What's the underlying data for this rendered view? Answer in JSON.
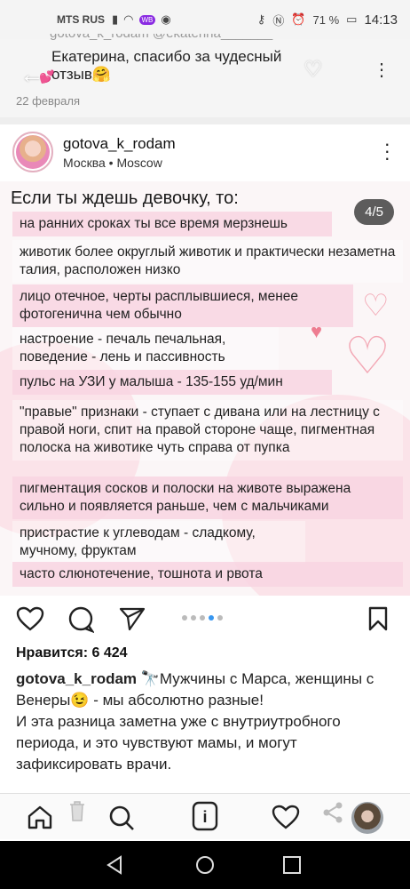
{
  "status_bar": {
    "carrier": "MTS RUS",
    "badge": "WB",
    "battery": "71 %",
    "time": "14:13"
  },
  "previous_post": {
    "cut_text": "gotova_k_rodam @ekaterina_______",
    "comment_text": "Екатерина, спасибо за чудесный отзыв🤗",
    "emoji": "💕",
    "date": "22 февраля"
  },
  "post": {
    "username": "gotova_k_rodam",
    "location": "Москва • Moscow",
    "slide_counter": "4/5",
    "slide": {
      "title": "Если ты ждешь девочку, то:",
      "lines": [
        "на ранних сроках ты все время мерзнешь",
        "животик более округлый животик и практически незаметна талия, расположен низко",
        "лицо отечное, черты расплывшиеся, менее фотогенична чем обычно",
        "настроение - печаль печальная, поведение - лень и пассивность",
        "пульс на УЗИ у малыша - 135-155 уд/мин",
        "\"правые\" признаки - ступает с дивана или на лестницу с правой ноги, спит на правой стороне чаще, пигментная полоска на животике чуть справа от пупка",
        "пигментация сосков и полоски на животе выражена сильно и появляется раньше, чем с мальчиками",
        "пристрастие к углеводам - сладкому, мучному, фруктам",
        "часто слюнотечение, тошнота и рвота"
      ]
    },
    "likes": "Нравится: 6 424",
    "caption_username": "gotova_k_rodam",
    "caption_line1": " 🔭Мужчины с Марса, женщины с Венеры😉 - мы абсолютно разные!",
    "caption_line2": "И эта разница заметна уже с внутриутробного периода, и это чувствуют мамы, и могут зафиксировать врачи."
  },
  "carousel": {
    "total": 5,
    "current": 4
  },
  "colors": {
    "accent": "#3897f0",
    "highlight": "#f8d5e2"
  }
}
